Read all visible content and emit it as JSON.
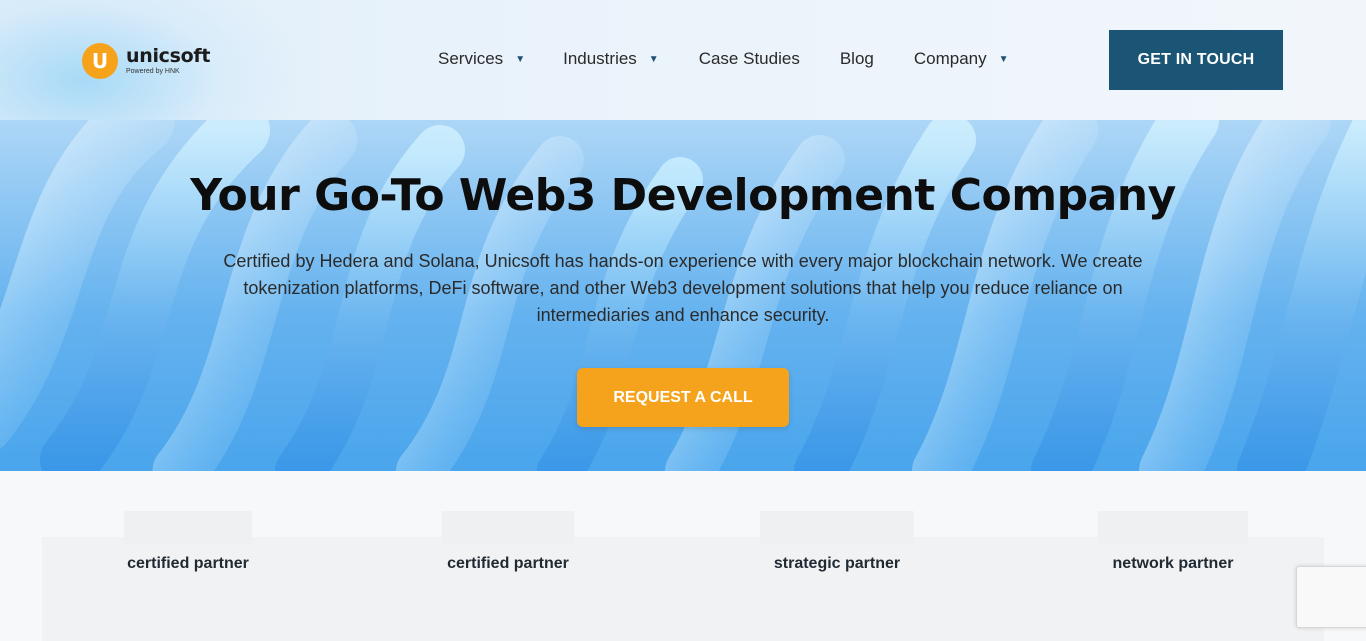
{
  "header": {
    "logo_mark": "U",
    "logo_name": "unicsoft",
    "logo_sub": "Powered by HNK",
    "nav": [
      {
        "label": "Services",
        "has_dropdown": true
      },
      {
        "label": "Industries",
        "has_dropdown": true
      },
      {
        "label": "Case Studies",
        "has_dropdown": false
      },
      {
        "label": "Blog",
        "has_dropdown": false
      },
      {
        "label": "Company",
        "has_dropdown": true
      }
    ],
    "cta_label": "GET IN TOUCH"
  },
  "hero": {
    "title": "Your Go-To Web3 Development Company",
    "description": "Certified by Hedera and Solana, Unicsoft has hands-on experience with every major blockchain network. We create tokenization platforms, DeFi software, and other Web3 development solutions that help you reduce reliance on intermediaries and enhance security.",
    "cta_label": "REQUEST A CALL"
  },
  "partners": [
    {
      "label": "certified partner"
    },
    {
      "label": "certified partner"
    },
    {
      "label": "strategic partner"
    },
    {
      "label": "network partner"
    }
  ],
  "colors": {
    "brand_orange": "#f5a31c",
    "brand_navy": "#1b5575",
    "hero_blue": "#2f8ee5"
  },
  "icons": {
    "dropdown": "caret-down-icon"
  }
}
